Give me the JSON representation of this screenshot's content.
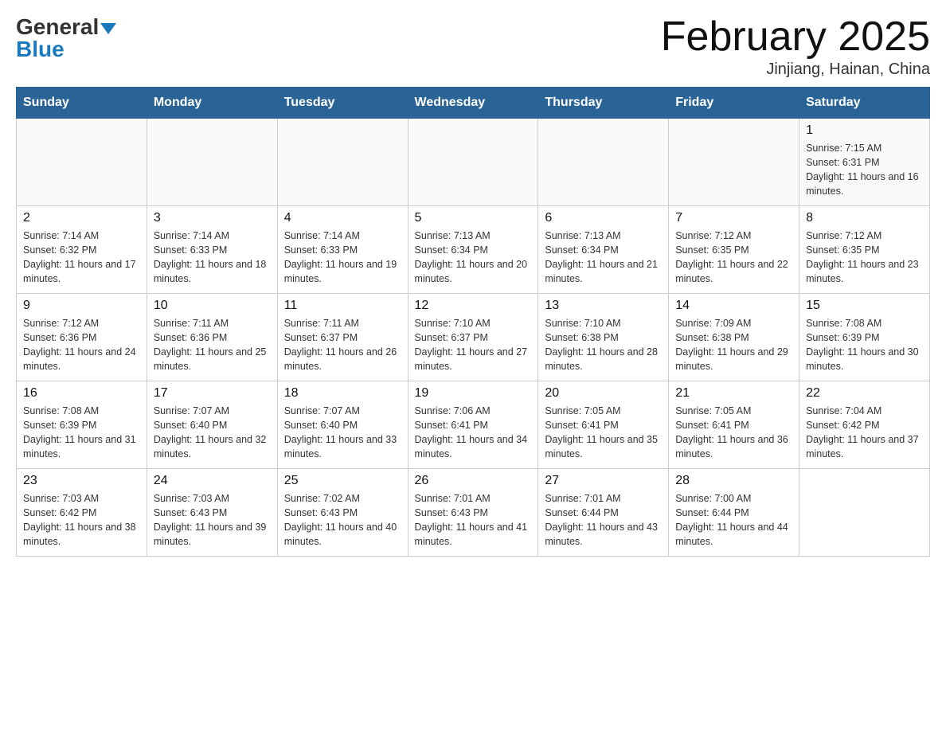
{
  "logo": {
    "part1": "General",
    "part2": "Blue"
  },
  "title": "February 2025",
  "location": "Jinjiang, Hainan, China",
  "weekdays": [
    "Sunday",
    "Monday",
    "Tuesday",
    "Wednesday",
    "Thursday",
    "Friday",
    "Saturday"
  ],
  "weeks": [
    [
      {
        "day": "",
        "info": ""
      },
      {
        "day": "",
        "info": ""
      },
      {
        "day": "",
        "info": ""
      },
      {
        "day": "",
        "info": ""
      },
      {
        "day": "",
        "info": ""
      },
      {
        "day": "",
        "info": ""
      },
      {
        "day": "1",
        "info": "Sunrise: 7:15 AM\nSunset: 6:31 PM\nDaylight: 11 hours and 16 minutes."
      }
    ],
    [
      {
        "day": "2",
        "info": "Sunrise: 7:14 AM\nSunset: 6:32 PM\nDaylight: 11 hours and 17 minutes."
      },
      {
        "day": "3",
        "info": "Sunrise: 7:14 AM\nSunset: 6:33 PM\nDaylight: 11 hours and 18 minutes."
      },
      {
        "day": "4",
        "info": "Sunrise: 7:14 AM\nSunset: 6:33 PM\nDaylight: 11 hours and 19 minutes."
      },
      {
        "day": "5",
        "info": "Sunrise: 7:13 AM\nSunset: 6:34 PM\nDaylight: 11 hours and 20 minutes."
      },
      {
        "day": "6",
        "info": "Sunrise: 7:13 AM\nSunset: 6:34 PM\nDaylight: 11 hours and 21 minutes."
      },
      {
        "day": "7",
        "info": "Sunrise: 7:12 AM\nSunset: 6:35 PM\nDaylight: 11 hours and 22 minutes."
      },
      {
        "day": "8",
        "info": "Sunrise: 7:12 AM\nSunset: 6:35 PM\nDaylight: 11 hours and 23 minutes."
      }
    ],
    [
      {
        "day": "9",
        "info": "Sunrise: 7:12 AM\nSunset: 6:36 PM\nDaylight: 11 hours and 24 minutes."
      },
      {
        "day": "10",
        "info": "Sunrise: 7:11 AM\nSunset: 6:36 PM\nDaylight: 11 hours and 25 minutes."
      },
      {
        "day": "11",
        "info": "Sunrise: 7:11 AM\nSunset: 6:37 PM\nDaylight: 11 hours and 26 minutes."
      },
      {
        "day": "12",
        "info": "Sunrise: 7:10 AM\nSunset: 6:37 PM\nDaylight: 11 hours and 27 minutes."
      },
      {
        "day": "13",
        "info": "Sunrise: 7:10 AM\nSunset: 6:38 PM\nDaylight: 11 hours and 28 minutes."
      },
      {
        "day": "14",
        "info": "Sunrise: 7:09 AM\nSunset: 6:38 PM\nDaylight: 11 hours and 29 minutes."
      },
      {
        "day": "15",
        "info": "Sunrise: 7:08 AM\nSunset: 6:39 PM\nDaylight: 11 hours and 30 minutes."
      }
    ],
    [
      {
        "day": "16",
        "info": "Sunrise: 7:08 AM\nSunset: 6:39 PM\nDaylight: 11 hours and 31 minutes."
      },
      {
        "day": "17",
        "info": "Sunrise: 7:07 AM\nSunset: 6:40 PM\nDaylight: 11 hours and 32 minutes."
      },
      {
        "day": "18",
        "info": "Sunrise: 7:07 AM\nSunset: 6:40 PM\nDaylight: 11 hours and 33 minutes."
      },
      {
        "day": "19",
        "info": "Sunrise: 7:06 AM\nSunset: 6:41 PM\nDaylight: 11 hours and 34 minutes."
      },
      {
        "day": "20",
        "info": "Sunrise: 7:05 AM\nSunset: 6:41 PM\nDaylight: 11 hours and 35 minutes."
      },
      {
        "day": "21",
        "info": "Sunrise: 7:05 AM\nSunset: 6:41 PM\nDaylight: 11 hours and 36 minutes."
      },
      {
        "day": "22",
        "info": "Sunrise: 7:04 AM\nSunset: 6:42 PM\nDaylight: 11 hours and 37 minutes."
      }
    ],
    [
      {
        "day": "23",
        "info": "Sunrise: 7:03 AM\nSunset: 6:42 PM\nDaylight: 11 hours and 38 minutes."
      },
      {
        "day": "24",
        "info": "Sunrise: 7:03 AM\nSunset: 6:43 PM\nDaylight: 11 hours and 39 minutes."
      },
      {
        "day": "25",
        "info": "Sunrise: 7:02 AM\nSunset: 6:43 PM\nDaylight: 11 hours and 40 minutes."
      },
      {
        "day": "26",
        "info": "Sunrise: 7:01 AM\nSunset: 6:43 PM\nDaylight: 11 hours and 41 minutes."
      },
      {
        "day": "27",
        "info": "Sunrise: 7:01 AM\nSunset: 6:44 PM\nDaylight: 11 hours and 43 minutes."
      },
      {
        "day": "28",
        "info": "Sunrise: 7:00 AM\nSunset: 6:44 PM\nDaylight: 11 hours and 44 minutes."
      },
      {
        "day": "",
        "info": ""
      }
    ]
  ]
}
